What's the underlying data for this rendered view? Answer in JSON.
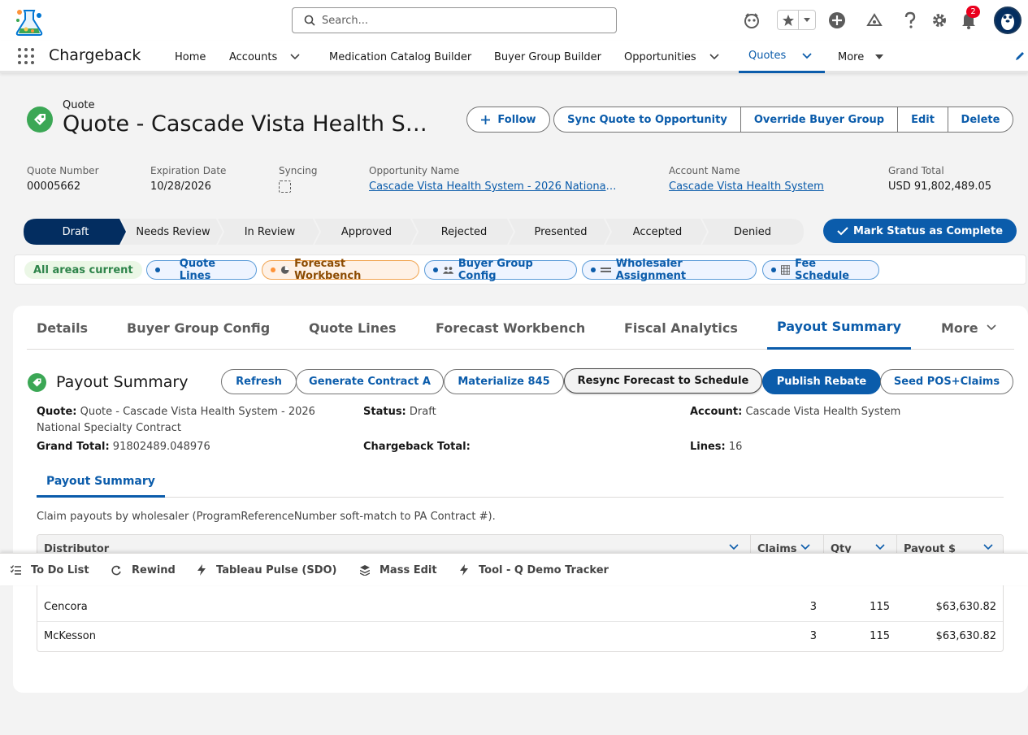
{
  "header": {
    "search_placeholder": "Search...",
    "notification_count": "2"
  },
  "nav": {
    "app_name": "Chargeback",
    "items": [
      "Home",
      "Accounts",
      "Medication Catalog Builder",
      "Buyer Group Builder",
      "Opportunities",
      "Quotes",
      "More"
    ],
    "active": "Quotes"
  },
  "record": {
    "type": "Quote",
    "title": "Quote - Cascade Vista Health System - 2026 National Specialty Contract",
    "actions": [
      "Follow",
      "Sync Quote to Opportunity",
      "Override Buyer Group",
      "Edit",
      "Delete"
    ],
    "fields": {
      "quote_number_label": "Quote Number",
      "quote_number": "00005662",
      "expiration_label": "Expiration Date",
      "expiration": "10/28/2026",
      "syncing_label": "Syncing",
      "opportunity_label": "Opportunity Name",
      "opportunity": "Cascade Vista Health System - 2026 National Specialty Contract",
      "account_label": "Account Name",
      "account": "Cascade Vista Health System",
      "grand_total_label": "Grand Total",
      "grand_total": "USD 91,802,489.05"
    }
  },
  "path": {
    "steps": [
      "Draft",
      "Needs Review",
      "In Review",
      "Approved",
      "Rejected",
      "Presented",
      "Accepted",
      "Denied"
    ],
    "current": "Draft",
    "complete_label": "Mark Status as Complete"
  },
  "areas": {
    "status": "All areas current",
    "chips": [
      "Quote Lines",
      "Forecast Workbench",
      "Buyer Group Config",
      "Wholesaler Assignment",
      "Fee Schedule"
    ]
  },
  "tabs": {
    "items": [
      "Details",
      "Buyer Group Config",
      "Quote Lines",
      "Forecast Workbench",
      "Fiscal Analytics",
      "Payout Summary",
      "More"
    ],
    "active": "Payout Summary"
  },
  "payout": {
    "title": "Payout Summary",
    "buttons": [
      "Refresh",
      "Generate Contract A",
      "Materialize 845",
      "Resync Forecast to Schedule",
      "Publish Rebate",
      "Seed POS+Claims"
    ],
    "info": {
      "quote_label": "Quote:",
      "quote": "Quote - Cascade Vista Health System - 2026 National Specialty Contract",
      "status_label": "Status:",
      "status": "Draft",
      "account_label": "Account:",
      "account": "Cascade Vista Health System",
      "grand_total_label": "Grand Total:",
      "grand_total": "91802489.048976",
      "chargeback_label": "Chargeback Total:",
      "lines_label": "Lines:",
      "lines": "16"
    },
    "subtab": "Payout Summary",
    "description": "Claim payouts by wholesaler (ProgramReferenceNumber soft-match to PA Contract #).",
    "table": {
      "columns": [
        "Distributor",
        "Claims",
        "Qty",
        "Payout $"
      ],
      "rows": [
        {
          "distributor": "Cencora",
          "claims": "3",
          "qty": "115",
          "payout": "$63,630.82"
        },
        {
          "distributor": "McKesson",
          "claims": "3",
          "qty": "115",
          "payout": "$63,630.82"
        }
      ]
    }
  },
  "utility": {
    "items": [
      "To Do List",
      "Rewind",
      "Tableau Pulse (SDO)",
      "Mass Edit",
      "Tool - Q Demo Tracker"
    ]
  }
}
